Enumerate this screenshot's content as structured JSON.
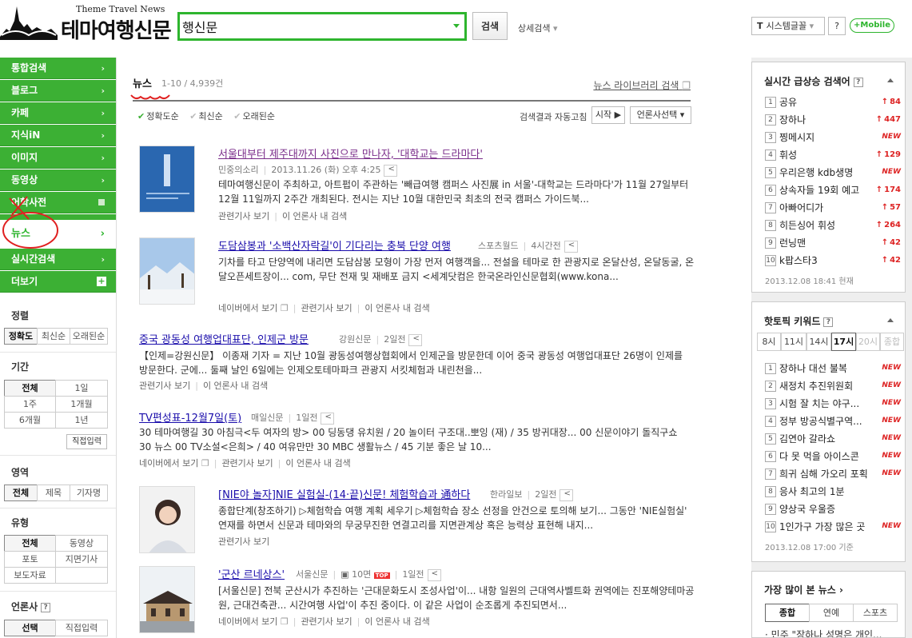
{
  "header": {
    "logo_sub": "Theme Travel News",
    "logo_title": "테마여행신문",
    "search_value": "행신문",
    "search_button": "검색",
    "advanced_search": "상세검색",
    "font_button": "시스템글꼴",
    "help": "?",
    "mobile": "+Mobile"
  },
  "sidebar": {
    "items": [
      {
        "label": "통합검색"
      },
      {
        "label": "블로그"
      },
      {
        "label": "카페"
      },
      {
        "label": "지식iN"
      },
      {
        "label": "이미지"
      },
      {
        "label": "동영상"
      },
      {
        "label": "어학사전"
      }
    ],
    "active": "뉴스",
    "items_after": [
      {
        "label": "실시간검색"
      },
      {
        "label": "더보기"
      }
    ],
    "sort": {
      "title": "정렬",
      "options": [
        "정확도",
        "최신순",
        "오래된순"
      ]
    },
    "period": {
      "title": "기간",
      "options": [
        "전체",
        "1일",
        "1주",
        "1개월",
        "6개월",
        "1년"
      ],
      "date_input": "직접입력"
    },
    "area": {
      "title": "영역",
      "options": [
        "전체",
        "제목",
        "기자명"
      ]
    },
    "type": {
      "title": "유형",
      "options": [
        "전체",
        "동영상",
        "포토",
        "지면기사",
        "보도자료"
      ]
    },
    "press": {
      "title": "언론사",
      "options": [
        "선택",
        "직접입력"
      ]
    }
  },
  "main": {
    "tab": "뉴스",
    "count": "1-10 / 4,939건",
    "library_link": "뉴스 라이브러리 검색",
    "sort_options": [
      {
        "label": "정확도순",
        "on": true
      },
      {
        "label": "최신순",
        "on": false
      },
      {
        "label": "오래된순",
        "on": false
      }
    ],
    "auto_refresh": "검색결과 자동고침",
    "start": "시작 ▶",
    "press_select": "언론사선택 ▾",
    "articles": [
      {
        "title": "서울대부터 제주대까지 사진으로 만나자, '대학교는 드라마다'",
        "source": "민중의소리",
        "date": "2013.11.26 (화) 오후 4:25",
        "body": "테마여행신문이 주최하고, 아트펍이 주관하는 '빼급여행 캠퍼스 사진展 in 서울'-대학교는 드라마다'가 11월 27일부터 12월 11일까지 2주간 개최된다. 전시는 지난 10월 대한민국 최초의 전국 캠퍼스 가이드북...",
        "links": [
          "관련기사 보기",
          "이 언론사 내 검색"
        ]
      },
      {
        "title": "도담삼봉과 '소백산자락길'이 기다리는 충북 단양 여행",
        "source": "스포츠월드",
        "date": "4시간전",
        "body": "기차를 타고 단양역에 내리면 도담삼봉 모형이 가장 먼저 여행객을... 전설을 테마로 한 관광지로 온달산성, 온달동굴, 온달오픈세트장이... com, 무단 전재 및 재배포 금지 <세계닷컴은 한국온라인신문협회(www.kona...",
        "links": [
          "네이버에서 보기",
          "관련기사 보기",
          "이 언론사 내 검색"
        ]
      },
      {
        "title": "중국 광동성 여행업대표단, 인제군 방문",
        "source": "강원신문",
        "date": "2일전",
        "body": "【인제=강원신문】 이종재 기자 = 지난 10월 광동성여행상협회에서 인제군을 방문한데 이어 중국 광동성 여행업대표단 26명이 인제를 방문한다. 군에... 둘째 날인 6일에는 인제오토테마파크 관광지 서킷체험과 내린천을...",
        "links": [
          "관련기사 보기",
          "이 언론사 내 검색"
        ]
      },
      {
        "title": "TV편성표-12월7일(토)",
        "source": "매일신문",
        "date": "1일전",
        "body": "30 테마여행길 30 아침극<두 여자의 방> 00 딩동댕 유치원 / 20 놀이터 구조대..뽀잉 (재) / 35 방귀대장... 00 신문이야기 돌직구쇼 30 뉴스 00 TV소설<은희> / 40 여유만만 30 MBC 생활뉴스 / 45 기분 좋은 날 10...",
        "links": [
          "네이버에서 보기",
          "관련기사 보기",
          "이 언론사 내 검색"
        ]
      },
      {
        "title": "[NIE야 놀자]NIE 실험실-(14·끝)신문! 체험학습과 通하다",
        "source": "한라일보",
        "date": "2일전",
        "body": "종합단계(창조하기) ▷체험학습 여행 계획 세우기 ▷체험학습 장소 선정을 안건으로 토의해 보기... 그동안 'NIE실험실' 연재를 하면서 신문과 테마와의 무궁무진한 연결고리를 지면관계상 혹은 능력상 표현해 내지...",
        "links": [
          "관련기사 보기"
        ]
      },
      {
        "title": "'군산 르네상스'",
        "source": "서울신문",
        "page": "10면",
        "top_badge": "TOP",
        "date": "1일전",
        "body": "[서울신문] 전북 군산시가 추진하는 '근대문화도시 조성사업'이... 내항 일원의 근대역사벨트화 권역에는 진포해양테마공원, 근대건축관... 시간여행 사업'이 추진 중이다. 이 같은 사업이 순조롭게 추진되면서...",
        "links": [
          "네이버에서 보기",
          "관련기사 보기",
          "이 언론사 내 검색"
        ]
      }
    ]
  },
  "right": {
    "rising": {
      "title": "실시간 급상승 검색어",
      "items": [
        {
          "rank": "1",
          "text": "공유",
          "delta": "84"
        },
        {
          "rank": "2",
          "text": "장하나",
          "delta": "447"
        },
        {
          "rank": "3",
          "text": "찡메시지",
          "delta": "NEW"
        },
        {
          "rank": "4",
          "text": "휘성",
          "delta": "129"
        },
        {
          "rank": "5",
          "text": "우리은행 kdb생명",
          "delta": "NEW"
        },
        {
          "rank": "6",
          "text": "상속자들 19회 예고",
          "delta": "174"
        },
        {
          "rank": "7",
          "text": "아빠어디가",
          "delta": "57"
        },
        {
          "rank": "8",
          "text": "히든싱어 휘성",
          "delta": "264"
        },
        {
          "rank": "9",
          "text": "런닝맨",
          "delta": "42"
        },
        {
          "rank": "10",
          "text": "k팝스타3",
          "delta": "42"
        }
      ],
      "stamp": "2013.12.08 18:41 현재"
    },
    "hot": {
      "title": "핫토픽 키워드",
      "hours": [
        "8시",
        "11시",
        "14시",
        "17시",
        "20시",
        "종합"
      ],
      "items": [
        {
          "rank": "1",
          "text": "장하나 대선 불복",
          "delta": "NEW"
        },
        {
          "rank": "2",
          "text": "새정치 추진위원회",
          "delta": "NEW"
        },
        {
          "rank": "3",
          "text": "시험 잘 치는 야구...",
          "delta": "NEW"
        },
        {
          "rank": "4",
          "text": "정부 방공식별구역...",
          "delta": "NEW"
        },
        {
          "rank": "5",
          "text": "김연아 갈라쇼",
          "delta": "NEW"
        },
        {
          "rank": "6",
          "text": "다 못 먹을 아이스콘",
          "delta": "NEW"
        },
        {
          "rank": "7",
          "text": "희귀 심해 가오리 포획",
          "delta": "NEW"
        },
        {
          "rank": "8",
          "text": "응사 최고의 1분",
          "delta": ""
        },
        {
          "rank": "9",
          "text": "양상국 우울증",
          "delta": ""
        },
        {
          "rank": "10",
          "text": "1인가구 가장 많은 곳",
          "delta": "NEW"
        }
      ],
      "stamp": "2013.12.08 17:00 기준"
    },
    "popular": {
      "title": "가장 많이 본 뉴스",
      "tabs": [
        "종합",
        "연예",
        "스포츠"
      ],
      "first_item": "민주 \"장하나 성명은 개인..."
    }
  },
  "colors": {
    "brand_green": "#3cb034",
    "annot_red": "#e02020"
  }
}
